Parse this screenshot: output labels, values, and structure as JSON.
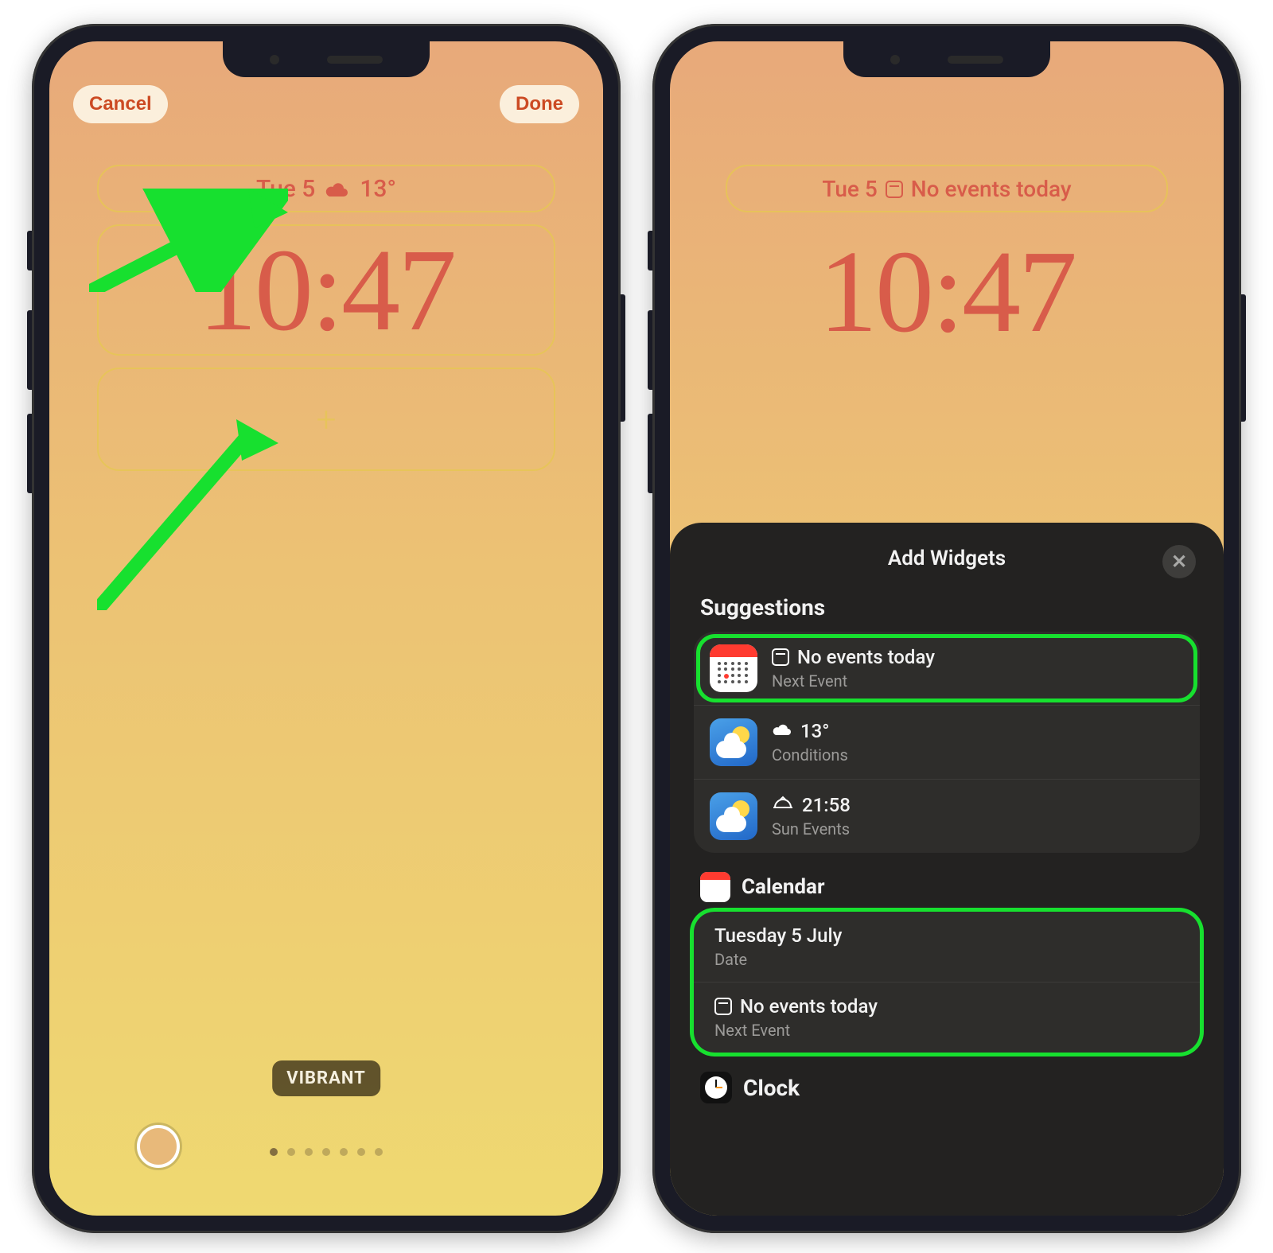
{
  "left": {
    "cancel": "Cancel",
    "done": "Done",
    "date": "Tue 5",
    "temp": "13°",
    "time": "10:47",
    "filter": "VIBRANT"
  },
  "right": {
    "date": "Tue 5",
    "event_text": "No events today",
    "time": "10:47",
    "sheet_title": "Add Widgets",
    "suggestions_title": "Suggestions",
    "sugg": [
      {
        "title": "No events today",
        "sub": "Next Event"
      },
      {
        "title": "13°",
        "sub": "Conditions"
      },
      {
        "title": "21:58",
        "sub": "Sun Events"
      }
    ],
    "calendar_section": "Calendar",
    "cal_rows": [
      {
        "title": "Tuesday 5 July",
        "sub": "Date"
      },
      {
        "title": "No events today",
        "sub": "Next Event"
      }
    ],
    "clock_section": "Clock"
  }
}
